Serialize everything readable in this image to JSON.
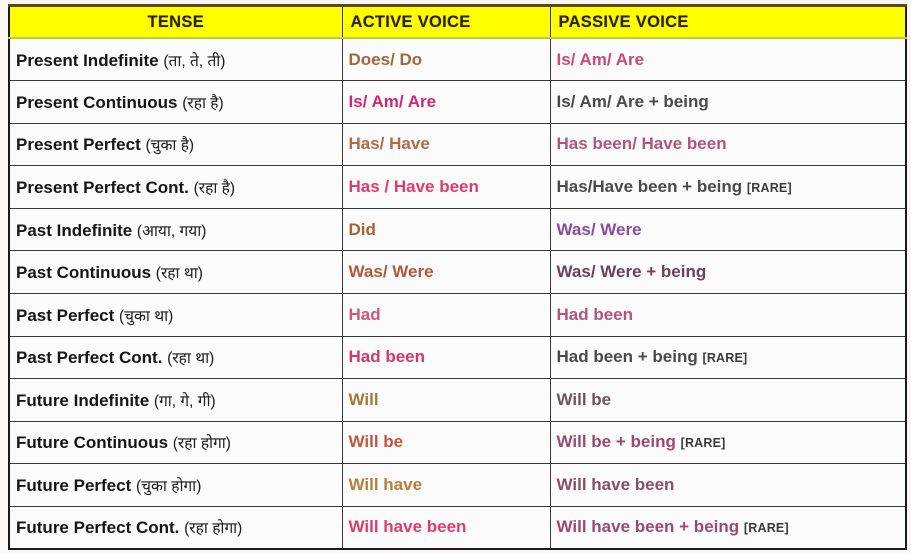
{
  "table": {
    "columns": [
      {
        "key": "tense",
        "label": "TENSE"
      },
      {
        "key": "active",
        "label": "ACTIVE VOICE"
      },
      {
        "key": "passive",
        "label": "PASSIVE VOICE"
      }
    ],
    "header": {
      "background": "#ffff00",
      "text_color": "#2b2200"
    },
    "rows": [
      {
        "tense_en": "Present Indefinite",
        "tense_hi": "(ता, ते, ती)",
        "active": "Does/ Do",
        "active_color": "#9c6b3c",
        "passive": "Is/ Am/ Are",
        "passive_color": "#c84a78",
        "passive_rare": ""
      },
      {
        "tense_en": "Present Continuous",
        "tense_hi": "(रहा है)",
        "active": "Is/ Am/ Are",
        "active_color": "#d6266b",
        "passive": "Is/ Am/ Are + being",
        "passive_color": "#4a4a4a",
        "passive_rare": ""
      },
      {
        "tense_en": "Present Perfect",
        "tense_hi": "(चुका है)",
        "active": "Has/ Have",
        "active_color": "#b06a4a",
        "passive": "Has been/ Have been",
        "passive_color": "#b2557a",
        "passive_rare": ""
      },
      {
        "tense_en": "Present Perfect Cont.",
        "tense_hi": "(रहा है)",
        "active": "Has / Have been",
        "active_color": "#e03a6e",
        "passive": "Has/Have been + being",
        "passive_color": "#4a4a4a",
        "passive_rare": "[RARE]"
      },
      {
        "tense_en": "Past Indefinite",
        "tense_hi": "(आया, गया)",
        "active": "Did",
        "active_color": "#a5642e",
        "passive": "Was/ Were",
        "passive_color": "#8a4d9e",
        "passive_rare": ""
      },
      {
        "tense_en": "Past Continuous",
        "tense_hi": "(रहा था)",
        "active": "Was/ Were",
        "active_color": "#b5563a",
        "passive": "Was/ Were + being",
        "passive_color": "#6a4356",
        "passive_rare": ""
      },
      {
        "tense_en": "Past Perfect",
        "tense_hi": "(चुका था)",
        "active": "Had",
        "active_color": "#d4557d",
        "passive": "Had been",
        "passive_color": "#b2557a",
        "passive_rare": ""
      },
      {
        "tense_en": "Past Perfect Cont.",
        "tense_hi": "(रहा था)",
        "active": "Had been",
        "active_color": "#d6376c",
        "passive": "Had been + being",
        "passive_color": "#4a4a4a",
        "passive_rare": "[RARE]"
      },
      {
        "tense_en": "Future Indefinite",
        "tense_hi": "(गा, गे, गी)",
        "active": "Will",
        "active_color": "#a07a3c",
        "passive": "Will be",
        "passive_color": "#6d5560",
        "passive_rare": ""
      },
      {
        "tense_en": "Future Continuous",
        "tense_hi": "(रहा होगा)",
        "active": "Will be",
        "active_color": "#c4563e",
        "passive": "Will be + being",
        "passive_color": "#9c4a6e",
        "passive_rare": "[RARE]"
      },
      {
        "tense_en": "Future Perfect",
        "tense_hi": "(चुका होगा)",
        "active": "Will have",
        "active_color": "#b5803a",
        "passive": "Will have been",
        "passive_color": "#8a4f66",
        "passive_rare": ""
      },
      {
        "tense_en": "Future Perfect Cont.",
        "tense_hi": "(रहा होगा)",
        "active": "Will have been",
        "active_color": "#e03a6e",
        "passive": "Will have been + being",
        "passive_color": "#9c4a6e",
        "passive_rare": "[RARE]"
      }
    ]
  }
}
